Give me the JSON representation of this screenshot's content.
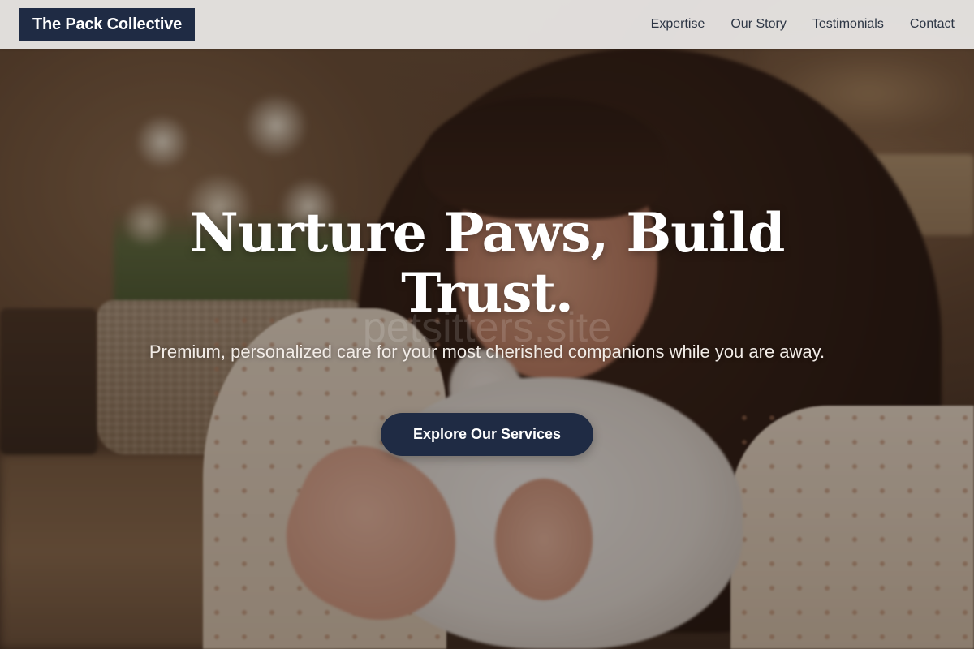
{
  "header": {
    "brand": "The Pack Collective",
    "nav": [
      {
        "label": "Expertise"
      },
      {
        "label": "Our Story"
      },
      {
        "label": "Testimonials"
      },
      {
        "label": "Contact"
      }
    ]
  },
  "hero": {
    "title": "Nurture Paws, Build Trust.",
    "watermark": "petsitters.site",
    "subtitle": "Premium, personalized care for your most cherished companions while you are away.",
    "cta_label": "Explore Our Services",
    "background_image": "woman-holding-white-rabbit-photo"
  },
  "colors": {
    "brand_navy": "#1f2b44",
    "header_bg": "#eceae8",
    "nav_text": "#2c3544",
    "title_text": "#ffffff"
  }
}
